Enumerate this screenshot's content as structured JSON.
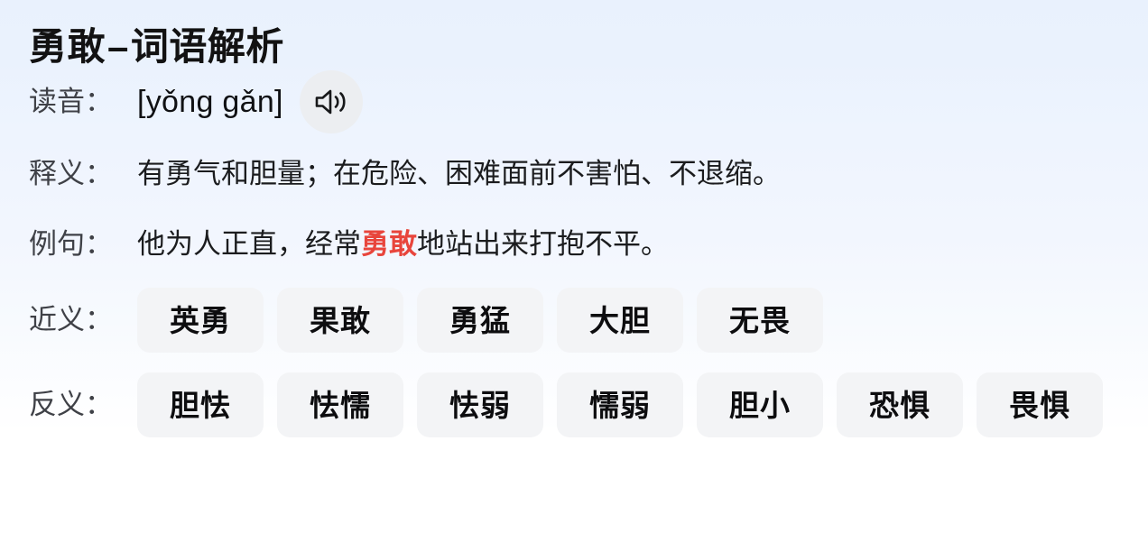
{
  "header": {
    "word": "勇敢",
    "separator": "–",
    "subtitle": "词语解析",
    "full_title": "勇敢 – 词语解析"
  },
  "reading": {
    "label": "读音：",
    "pinyin": "[yǒng gǎn]",
    "speaker_icon": "speaker-volume-icon"
  },
  "meaning": {
    "label": "释义：",
    "text": "有勇气和胆量；在危险、困难面前不害怕、不退缩。"
  },
  "example": {
    "label": "例句：",
    "before": "他为人正直，经常",
    "highlight": "勇敢",
    "after": "地站出来打抱不平。",
    "full_text": "他为人正直，经常勇敢地站出来打抱不平。",
    "highlight_color": "#e8453c"
  },
  "synonyms": {
    "label": "近义：",
    "items": [
      "英勇",
      "果敢",
      "勇猛",
      "大胆",
      "无畏"
    ]
  },
  "antonyms": {
    "label": "反义：",
    "items": [
      "胆怯",
      "怯懦",
      "怯弱",
      "懦弱",
      "胆小",
      "恐惧",
      "畏惧"
    ]
  },
  "colors": {
    "background_top": "#e9f1fd",
    "background_bottom": "#ffffff",
    "chip_background": "#f3f4f6",
    "label_text": "#3f4147",
    "body_text": "#1b1c1e",
    "highlight": "#e8453c",
    "speaker_circle": "#eceef1"
  }
}
